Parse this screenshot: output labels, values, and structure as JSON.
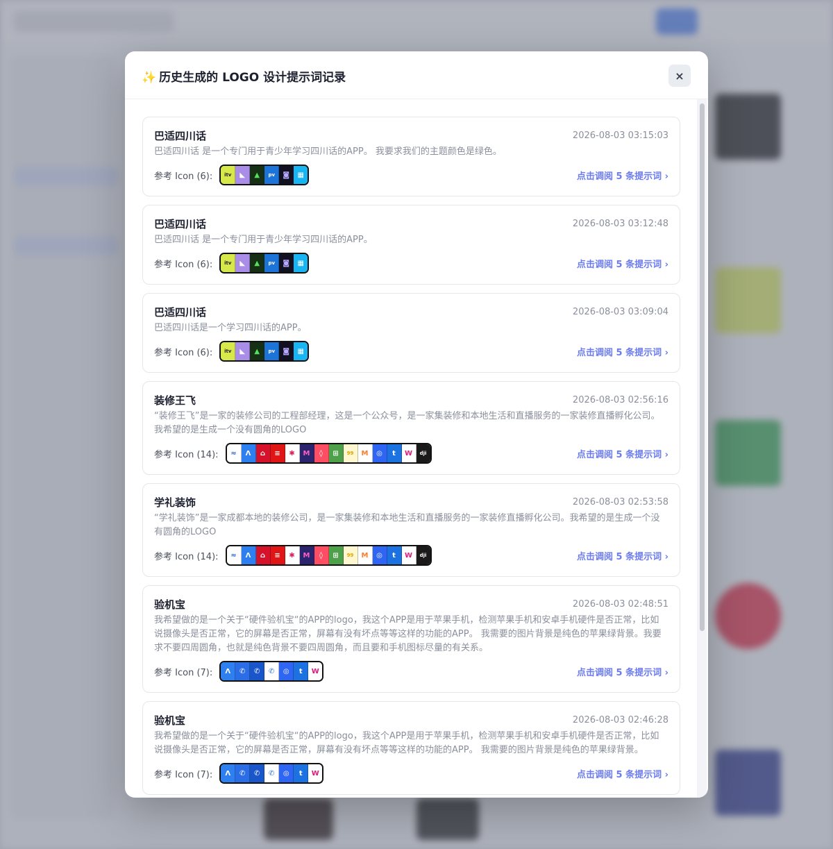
{
  "modal": {
    "title_icon": "✨",
    "title": "历史生成的 LOGO 设计提示词记录",
    "close_label": "×"
  },
  "ref_label_template": "参考 Icon",
  "link_label": "点击调阅 5 条提示词 ›",
  "icon_sets": {
    "set6": [
      {
        "name": "itv-icon",
        "bg": "#d7e84a",
        "fg": "#1b1b1b",
        "glyph": "itv"
      },
      {
        "name": "whale-icon",
        "bg": "#a98de8",
        "fg": "#ffffff",
        "glyph": "◣"
      },
      {
        "name": "mountain-icon",
        "bg": "#163016",
        "fg": "#58e05a",
        "glyph": "▲"
      },
      {
        "name": "prime-video-icon",
        "bg": "#1c74d9",
        "fg": "#ffffff",
        "glyph": "pv"
      },
      {
        "name": "chat-bubble-icon",
        "bg": "#111122",
        "fg": "#b9a9ff",
        "glyph": "◙"
      },
      {
        "name": "grid-icon",
        "bg": "#19b4f2",
        "fg": "#ffffff",
        "glyph": "▦"
      }
    ],
    "set14": [
      {
        "name": "blue-wave-icon",
        "bg": "#ffffff",
        "fg": "#2a62d6",
        "glyph": "≈"
      },
      {
        "name": "lambda-icon",
        "bg": "#2e7ff0",
        "fg": "#ffffff",
        "glyph": "Λ"
      },
      {
        "name": "red-house-icon",
        "bg": "#d6122a",
        "fg": "#ffffff",
        "glyph": "⌂"
      },
      {
        "name": "red-bars-icon",
        "bg": "#e01515",
        "fg": "#ffffff",
        "glyph": "≡"
      },
      {
        "name": "slack-icon",
        "bg": "#ffffff",
        "fg": "#e0225a",
        "glyph": "✱"
      },
      {
        "name": "m-purple-icon",
        "bg": "#2b2570",
        "fg": "#ff5fc0",
        "glyph": "M"
      },
      {
        "name": "airbnb-icon",
        "bg": "#ff4e63",
        "fg": "#ffffff",
        "glyph": "◊"
      },
      {
        "name": "green-square-icon",
        "bg": "#4fa04b",
        "fg": "#ffffff",
        "glyph": "⊞"
      },
      {
        "name": "99-icon",
        "bg": "#fff7d0",
        "fg": "#e5a400",
        "glyph": "99"
      },
      {
        "name": "m-gradient-icon",
        "bg": "#ffffff",
        "fg": "#ff7a2a",
        "glyph": "M"
      },
      {
        "name": "swirl-icon",
        "bg": "#2e65f2",
        "fg": "#ffffff",
        "glyph": "◎"
      },
      {
        "name": "t-icon",
        "bg": "#1b72e0",
        "fg": "#ffffff",
        "glyph": "t"
      },
      {
        "name": "w-icon",
        "bg": "#ffffff",
        "fg": "#e01a7a",
        "glyph": "W"
      },
      {
        "name": "dji-icon",
        "bg": "#1a1a1a",
        "fg": "#ffffff",
        "glyph": "dji"
      }
    ],
    "set7": [
      {
        "name": "lambda-icon",
        "bg": "#2e7ff0",
        "fg": "#ffffff",
        "glyph": "Λ"
      },
      {
        "name": "phone-icon",
        "bg": "#2a6de6",
        "fg": "#ffffff",
        "glyph": "✆"
      },
      {
        "name": "phone-dark-icon",
        "bg": "#1956c9",
        "fg": "#ffffff",
        "glyph": "✆"
      },
      {
        "name": "phone-light-icon",
        "bg": "#ffffff",
        "fg": "#2a6de6",
        "glyph": "✆"
      },
      {
        "name": "swirl-icon",
        "bg": "#2e65f2",
        "fg": "#ffffff",
        "glyph": "◎"
      },
      {
        "name": "t-icon",
        "bg": "#1b72e0",
        "fg": "#ffffff",
        "glyph": "t"
      },
      {
        "name": "w-icon",
        "bg": "#ffffff",
        "fg": "#e01a7a",
        "glyph": "W"
      }
    ]
  },
  "records": [
    {
      "name": "巴适四川话",
      "time": "2026-08-03 03:15:03",
      "desc": "巴适四川话 是一个专门用于青少年学习四川话的APP。 我要求我们的主题颜色是绿色。",
      "count": "(6):",
      "icons": "set6"
    },
    {
      "name": "巴适四川话",
      "time": "2026-08-03 03:12:48",
      "desc": "巴适四川话 是一个专门用于青少年学习四川话的APP。",
      "count": "(6):",
      "icons": "set6"
    },
    {
      "name": "巴适四川话",
      "time": "2026-08-03 03:09:04",
      "desc": "巴适四川话是一个学习四川话的APP。",
      "count": "(6):",
      "icons": "set6"
    },
    {
      "name": "装修王飞",
      "time": "2026-08-03 02:56:16",
      "desc": "“装修王飞”是一家的装修公司的工程部经理，这是一个公众号，是一家集装修和本地生活和直播服务的一家装修直播孵化公司。 我希望的是生成一个没有圆角的LOGO",
      "count": "(14):",
      "icons": "set14"
    },
    {
      "name": "学礼装饰",
      "time": "2026-08-03 02:53:58",
      "desc": "“学礼装饰”是一家成都本地的装修公司，是一家集装修和本地生活和直播服务的一家装修直播孵化公司。我希望的是生成一个没有圆角的LOGO",
      "count": "(14):",
      "icons": "set14"
    },
    {
      "name": "验机宝",
      "time": "2026-08-03 02:48:51",
      "desc": "我希望做的是一个关于“硬件验机宝“的APP的logo，我这个APP是用于苹果手机，检测苹果手机和安卓手机硬件是否正常，比如说摄像头是否正常，它的屏幕是否正常，屏幕有没有坏点等等这样的功能的APP。 我需要的图片背景是纯色的苹果绿背景。我要求不要四周圆角，也就是纯色背景不要四周圆角，而且要和手机图标尽量的有关系。",
      "count": "(7):",
      "icons": "set7"
    },
    {
      "name": "验机宝",
      "time": "2026-08-03 02:46:28",
      "desc": "我希望做的是一个关于“硬件验机宝“的APP的logo，我这个APP是用于苹果手机，检测苹果手机和安卓手机硬件是否正常，比如说摄像头是否正常，它的屏幕是否正常，屏幕有没有坏点等等这样的功能的APP。 我需要的图片背景是纯色的苹果绿背景。",
      "count": "(7):",
      "icons": "set7"
    }
  ]
}
